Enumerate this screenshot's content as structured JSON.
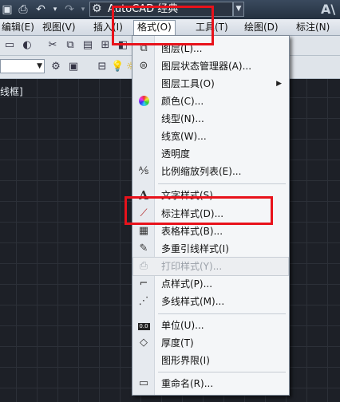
{
  "titlebar": {
    "workspace": "AutoCAD 经典",
    "app_letters": "A\\"
  },
  "menubar": {
    "items": [
      {
        "label": "编辑(E)"
      },
      {
        "label": "视图(V)"
      },
      {
        "label": "插入(I)"
      },
      {
        "label": "格式(O)"
      },
      {
        "label": "工具(T)"
      },
      {
        "label": "绘图(D)"
      },
      {
        "label": "标注(N)"
      }
    ]
  },
  "viewport": {
    "label": "线框]"
  },
  "format_menu": {
    "items": [
      {
        "label": "图层(L)...",
        "icon": "layer-icon"
      },
      {
        "label": "图层状态管理器(A)...",
        "icon": "layer-state-icon"
      },
      {
        "label": "图层工具(O)",
        "icon": "",
        "submenu": "▶"
      },
      {
        "label": "颜色(C)...",
        "icon": "color-wheel-icon"
      },
      {
        "label": "线型(N)...",
        "icon": ""
      },
      {
        "label": "线宽(W)...",
        "icon": ""
      },
      {
        "label": "透明度",
        "icon": ""
      },
      {
        "label": "比例缩放列表(E)...",
        "icon": "scale-list-icon"
      },
      {
        "label": "文字样式(S)...",
        "icon": "text-style-icon"
      },
      {
        "label": "标注样式(D)...",
        "icon": "dim-style-icon"
      },
      {
        "label": "表格样式(B)...",
        "icon": "table-style-icon"
      },
      {
        "label": "多重引线样式(I)",
        "icon": "mleader-style-icon"
      },
      {
        "label": "打印样式(Y)...",
        "icon": "plot-style-icon",
        "disabled": true
      },
      {
        "label": "点样式(P)...",
        "icon": "point-style-icon"
      },
      {
        "label": "多线样式(M)...",
        "icon": "mline-style-icon"
      },
      {
        "label": "单位(U)...",
        "icon": "units-icon"
      },
      {
        "label": "厚度(T)",
        "icon": "thickness-icon"
      },
      {
        "label": "图形界限(I)",
        "icon": ""
      },
      {
        "label": "重命名(R)...",
        "icon": "rename-icon"
      }
    ]
  }
}
